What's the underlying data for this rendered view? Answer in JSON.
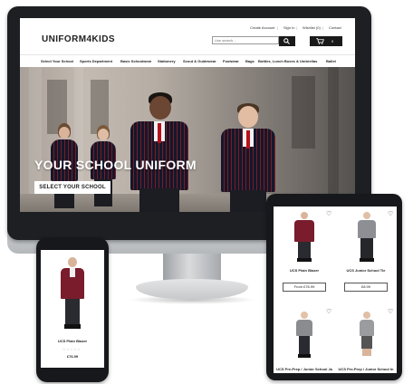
{
  "topbar": {
    "create_account": "Create Account",
    "sep1": "|",
    "sign_in": "Sign In",
    "sep2": "|",
    "wishlist": "Wishlist (0)",
    "sep3": "|",
    "contact": "Contact"
  },
  "header": {
    "logo": "UNIFORM4KIDS",
    "search_placeholder": "Use search...",
    "search_icon": "search-icon",
    "cart_icon": "cart-icon",
    "cart_count": "0"
  },
  "nav": {
    "items": [
      "Select Your School",
      "Sports Department",
      "Basic Schoolwear",
      "Stationery",
      "Scout & Guidewear",
      "Footwear",
      "Bags",
      "Bottles, Lunch Boxes & Umbrellas",
      "Ballet"
    ]
  },
  "hero": {
    "title": "YOUR SCHOOL UNIFORM",
    "button": "SELECT YOUR SCHOOL"
  },
  "tablet": {
    "products": [
      {
        "name": "UCS Plain Blazer",
        "price": "From £76.99"
      },
      {
        "name": "UCS Junior School Tie",
        "price": "£8.99"
      },
      {
        "name": "UCS Pre-Prep / Junior School Ja",
        "price": ""
      },
      {
        "name": "UCS Pre-Prep / Junior School In",
        "price": ""
      }
    ],
    "wishlist_icon": "heart-icon"
  },
  "phone": {
    "product_name": "UCS Plain Blazer",
    "rating_stars": "☆☆☆☆☆",
    "price": "£76.99"
  },
  "colors": {
    "accent_dark": "#1a1a1a",
    "blazer_navy": "#14172b",
    "blazer_stripe": "#7a1c24",
    "tie_red": "#b5121b"
  }
}
